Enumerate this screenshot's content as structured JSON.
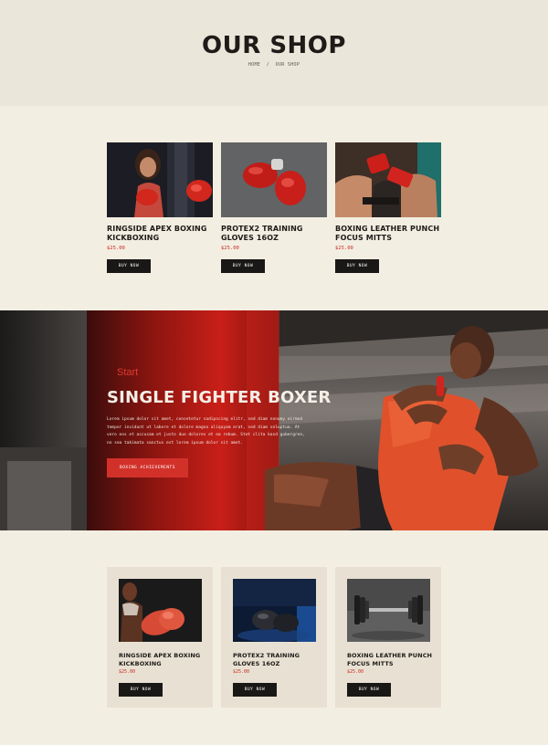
{
  "header": {
    "title": "OUR SHOP",
    "breadcrumb": {
      "home": "HOME",
      "separator": "/",
      "current": "OUR SHOP"
    }
  },
  "shop_top": {
    "products": [
      {
        "name": "RINGSIDE APEX BOXING KICKBOXING",
        "price": "$25.00",
        "button": "BUY NOW",
        "image": "woman-with-red-boxing-gloves"
      },
      {
        "name": "PROTEX2 TRAINING GLOVES 16OZ",
        "price": "$25.00",
        "button": "BUY NOW",
        "image": "red-boxing-gloves-on-floor"
      },
      {
        "name": "BOXING LEATHER PUNCH FOCUS MITTS",
        "price": "$25.00",
        "button": "BUY NOW",
        "image": "hands-wrapped-in-red-tape"
      }
    ]
  },
  "hero": {
    "kicker": "Start",
    "title": "SINGLE FIGHTER BOXER",
    "body": "Lorem ipsum dolor sit amet, consetetur sadipscing elitr, sed diam nonumy eirmod tempor invidunt ut labore et dolore magna aliquyam erat, sed diam voluptua. At vero eos et accusam et justo duo dolores et ea rebum. Stet clita kasd gubergren, no sea takimata sanctus est lorem ipsum dolor sit amet.",
    "button": "BOXING ACHIEVEMENTS",
    "image": "woman-kicking-red-punching-bag"
  },
  "shop_bottom": {
    "products": [
      {
        "name": "RINGSIDE APEX BOXING KICKBOXING",
        "price": "$25.00",
        "button": "BUY NOW",
        "image": "boxer-with-red-gloves"
      },
      {
        "name": "PROTEX2 TRAINING GLOVES 16OZ",
        "price": "$25.00",
        "button": "BUY NOW",
        "image": "black-gloves-on-blue-floor"
      },
      {
        "name": "BOXING LEATHER PUNCH FOCUS MITTS",
        "price": "$25.00",
        "button": "BUY NOW",
        "image": "dumbbell-on-grey"
      }
    ]
  },
  "colors": {
    "accent_red": "#c72a22",
    "button_dark": "#1a1816",
    "page_bg": "#f3eee2",
    "header_bg": "#ebe6da",
    "card_bg": "#e8e1d3"
  }
}
